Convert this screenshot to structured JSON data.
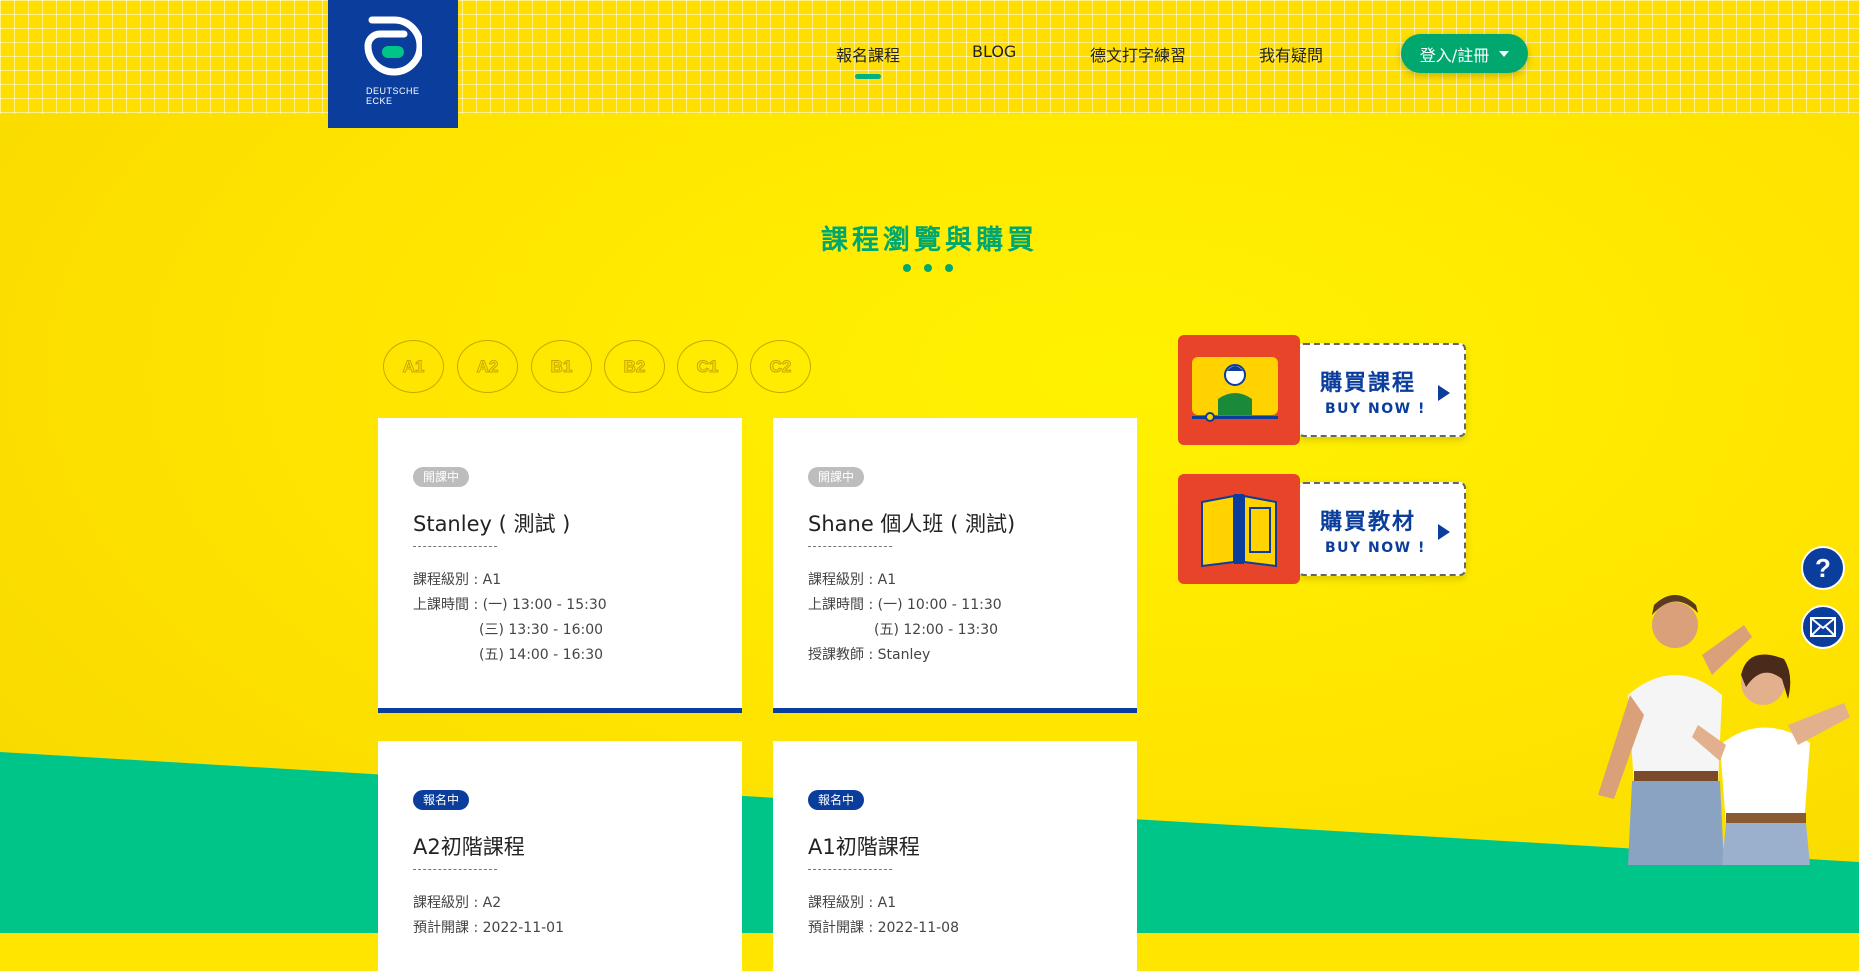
{
  "brand": {
    "logo_line1": "DEUTSCHE",
    "logo_line2": "ECKE"
  },
  "nav": {
    "items": [
      {
        "label": "報名課程",
        "active": true
      },
      {
        "label": "BLOG"
      },
      {
        "label": "德文打字練習"
      },
      {
        "label": "我有疑問"
      }
    ],
    "login_label": "登入/註冊"
  },
  "section": {
    "title": "課程瀏覽與購買"
  },
  "levels": [
    "A1",
    "A2",
    "B1",
    "B2",
    "C1",
    "C2"
  ],
  "courses": [
    {
      "status": "開課中",
      "title": "Stanley ( 測試 )",
      "lines": [
        "課程級別 : A1",
        "上課時間 : (一) 13:00 - 15:30",
        "(三) 13:30 - 16:00",
        "(五) 14:00 - 16:30"
      ]
    },
    {
      "status": "開課中",
      "title": "Shane 個人班 ( 測試)",
      "lines": [
        "課程級別 : A1",
        "上課時間 : (一) 10:00 - 11:30",
        "(五) 12:00 - 13:30",
        "授課教師 : Stanley"
      ]
    },
    {
      "status": "報名中",
      "title": "A2初階課程",
      "lines": [
        "課程級別 : A2",
        "預計開課 : 2022-11-01"
      ]
    },
    {
      "status": "報名中",
      "title": "A1初階課程",
      "lines": [
        "課程級別 : A1",
        "預計開課 : 2022-11-08"
      ]
    }
  ],
  "buy": [
    {
      "label_zh": "購買課程",
      "label_en": "BUY NOW !",
      "icon": "video-lesson-icon"
    },
    {
      "label_zh": "購買教材",
      "label_en": "BUY NOW !",
      "icon": "book-icon"
    }
  ],
  "floating": {
    "help_glyph": "?",
    "help_icon": "question-icon",
    "mail_icon": "mail-icon"
  },
  "colors": {
    "yellow": "#ffe600",
    "green": "#00c589",
    "accent_green": "#00a870",
    "navy": "#0a3d9c",
    "red": "#e8442a"
  }
}
